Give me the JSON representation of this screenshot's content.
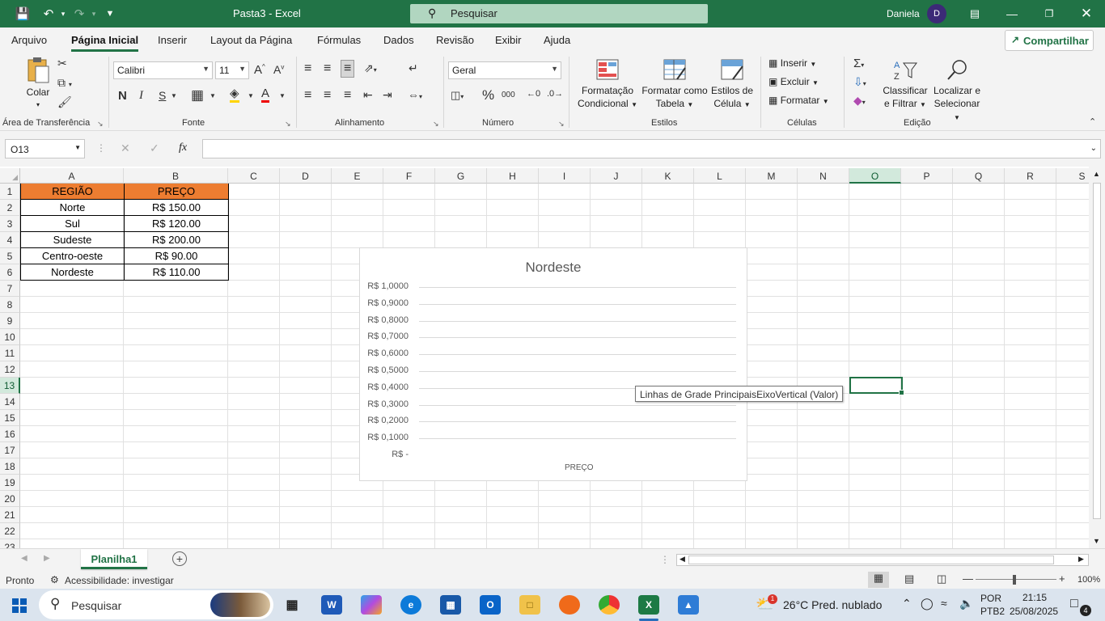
{
  "titlebar": {
    "doc_title": "Pasta3  -  Excel",
    "search_placeholder": "Pesquisar",
    "user_name": "Daniela",
    "user_initial": "D"
  },
  "tabs": [
    "Arquivo",
    "Página Inicial",
    "Inserir",
    "Layout da Página",
    "Fórmulas",
    "Dados",
    "Revisão",
    "Exibir",
    "Ajuda"
  ],
  "share_label": "Compartilhar",
  "ribbon": {
    "clipboard": {
      "paste": "Colar",
      "group": "Área de Transferência"
    },
    "font": {
      "name": "Calibri",
      "size": "11",
      "bold": "N",
      "italic": "I",
      "underline": "S",
      "group": "Fonte"
    },
    "alignment": {
      "group": "Alinhamento"
    },
    "number": {
      "format": "Geral",
      "group": "Número",
      "percent": "%",
      "thousands": "000"
    },
    "styles": {
      "conditional_1": "Formatação",
      "conditional_2": "Condicional",
      "table_1": "Formatar como",
      "table_2": "Tabela",
      "cell_1": "Estilos de",
      "cell_2": "Célula",
      "group": "Estilos"
    },
    "cells": {
      "insert": "Inserir",
      "delete": "Excluir",
      "format": "Formatar",
      "group": "Células"
    },
    "editing": {
      "sort_1": "Classificar",
      "sort_2": "e Filtrar",
      "find_1": "Localizar e",
      "find_2": "Selecionar",
      "group": "Edição"
    }
  },
  "formula_bar": {
    "name_box": "O13",
    "fx": "fx",
    "formula": ""
  },
  "columns": [
    "A",
    "B",
    "C",
    "D",
    "E",
    "F",
    "G",
    "H",
    "I",
    "J",
    "K",
    "L",
    "M",
    "N",
    "O",
    "P",
    "Q",
    "R",
    "S"
  ],
  "rows": [
    "1",
    "2",
    "3",
    "4",
    "5",
    "6",
    "7",
    "8",
    "9",
    "10",
    "11",
    "12",
    "13",
    "14",
    "15",
    "16",
    "17",
    "18",
    "19",
    "20",
    "21",
    "22",
    "23"
  ],
  "table": {
    "headers": [
      "REGIÃO",
      "PREÇO"
    ],
    "rows": [
      [
        "Norte",
        "R$ 150.00"
      ],
      [
        "Sul",
        "R$ 120.00"
      ],
      [
        "Sudeste",
        "R$ 200.00"
      ],
      [
        "Centro-oeste",
        "R$ 90.00"
      ],
      [
        "Nordeste",
        "R$ 110.00"
      ]
    ]
  },
  "chart_data": {
    "type": "bar",
    "title": "Nordeste",
    "categories": [
      "PREÇO"
    ],
    "series": [],
    "ylim": [
      0,
      1
    ],
    "yticks": [
      "R$ 1,0000",
      "R$ 0,9000",
      "R$ 0,8000",
      "R$ 0,7000",
      "R$ 0,6000",
      "R$ 0,5000",
      "R$ 0,4000",
      "R$ 0,3000",
      "R$ 0,2000",
      "R$ 0,1000",
      "R$ -"
    ],
    "xlabel": "",
    "grid": true
  },
  "tooltip": "Linhas de Grade PrincipaisEixoVertical (Valor)",
  "sheets": {
    "active": "Planilha1"
  },
  "status": {
    "ready": "Pronto",
    "accessibility": "Acessibilidade: investigar",
    "zoom": "100%"
  },
  "taskbar": {
    "search": "Pesquisar",
    "weather": "26°C  Pred. nublado",
    "lang_1": "POR",
    "lang_2": "PTB2",
    "time": "21:15",
    "date": "25/08/2025",
    "notifications": "4",
    "weather_badge": "1"
  },
  "colors": {
    "excel_green": "#217346",
    "header_fill": "#ed7d31"
  }
}
